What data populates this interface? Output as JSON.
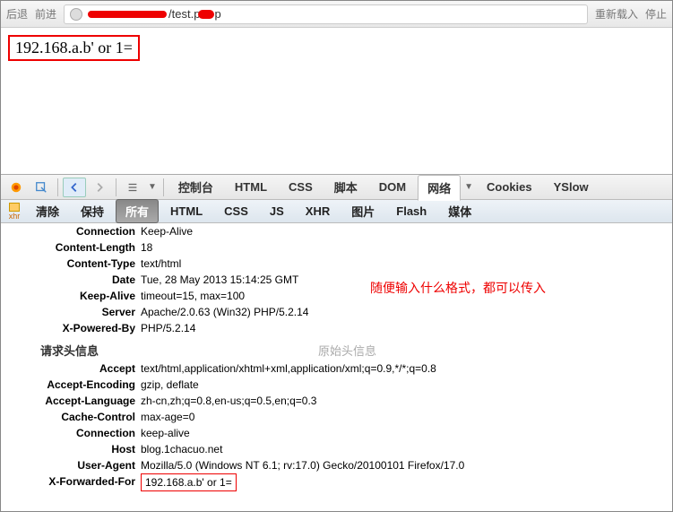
{
  "nav": {
    "back": "后退",
    "forward": "前进",
    "url_suffix": "/test.p",
    "url_end": "p",
    "reload": "重新载入",
    "stop": "停止"
  },
  "page": {
    "ip_text": "192.168.a.b' or 1="
  },
  "tb1": {
    "console": "控制台",
    "html": "HTML",
    "css": "CSS",
    "script": "脚本",
    "dom": "DOM",
    "net": "网络",
    "cookies": "Cookies",
    "yslow": "YSlow"
  },
  "tb2": {
    "xhr_label": "xhr",
    "clear": "清除",
    "persist": "保持",
    "all": "所有",
    "html": "HTML",
    "css": "CSS",
    "js": "JS",
    "xhr": "XHR",
    "images": "图片",
    "flash": "Flash",
    "media": "媒体"
  },
  "resp": {
    "connection_k": "Connection",
    "connection_v": "Keep-Alive",
    "clen_k": "Content-Length",
    "clen_v": "18",
    "ctype_k": "Content-Type",
    "ctype_v": "text/html",
    "date_k": "Date",
    "date_v": "Tue, 28 May 2013 15:14:25 GMT",
    "ka_k": "Keep-Alive",
    "ka_v": "timeout=15, max=100",
    "server_k": "Server",
    "server_v": "Apache/2.0.63 (Win32) PHP/5.2.14",
    "xpb_k": "X-Powered-By",
    "xpb_v": "PHP/5.2.14"
  },
  "sections": {
    "req": "请求头信息",
    "raw": "原始头信息"
  },
  "req": {
    "accept_k": "Accept",
    "accept_v": "text/html,application/xhtml+xml,application/xml;q=0.9,*/*;q=0.8",
    "ae_k": "Accept-Encoding",
    "ae_v": "gzip, deflate",
    "al_k": "Accept-Language",
    "al_v": "zh-cn,zh;q=0.8,en-us;q=0.5,en;q=0.3",
    "cc_k": "Cache-Control",
    "cc_v": "max-age=0",
    "conn_k": "Connection",
    "conn_v": "keep-alive",
    "host_k": "Host",
    "host_v": "blog.1chacuo.net",
    "ua_k": "User-Agent",
    "ua_v": "Mozilla/5.0 (Windows NT 6.1; rv:17.0) Gecko/20100101 Firefox/17.0",
    "xff_k": "X-Forwarded-For",
    "xff_v": "192.168.a.b' or 1="
  },
  "annot": {
    "text": "随便输入什么格式，都可以传入"
  }
}
